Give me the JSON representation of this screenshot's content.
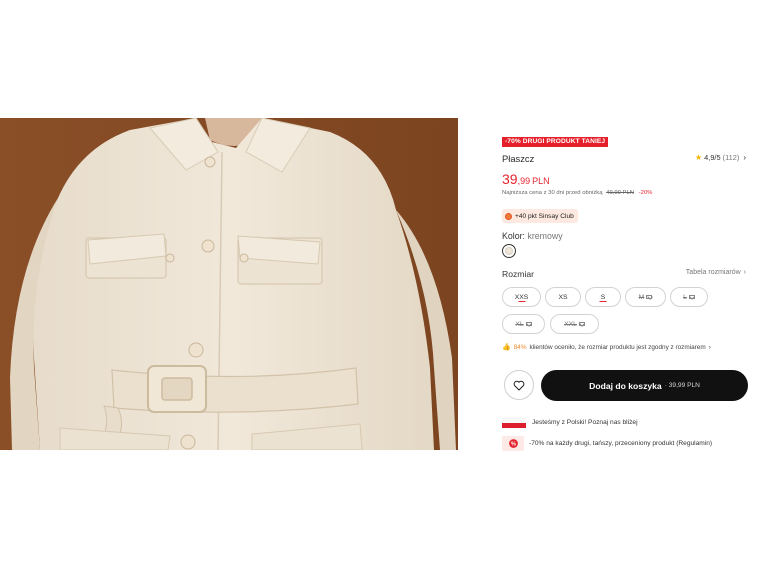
{
  "product": {
    "image_alt": "Płaszcz",
    "badge": "-70% DRUGI PRODUKT TANIEJ",
    "name": "Płaszcz",
    "rating": {
      "score": "4,9/5",
      "count": "(112)",
      "stars": 4.9
    },
    "price": {
      "integer": "39",
      "decimal": ",99",
      "currency": "PLN"
    },
    "lowest_price": {
      "text": "Najniższa cena z 30 dni przed obniżką",
      "old_price": "49,99 PLN",
      "discount": "-20%"
    },
    "club": {
      "label": "+40 pkt Sinsay Club"
    },
    "color": {
      "label": "Kolor:",
      "value": "kremowy",
      "swatch": "#efe6da"
    },
    "sizes": {
      "label": "Rozmiar",
      "table_link": "Tabela rozmiarów",
      "options": [
        {
          "name": "XXS",
          "available": true,
          "low_stock": true
        },
        {
          "name": "XS",
          "available": true,
          "low_stock": false
        },
        {
          "name": "S",
          "available": true,
          "low_stock": true
        },
        {
          "name": "M",
          "available": false,
          "notify": true
        },
        {
          "name": "L",
          "available": false,
          "notify": true
        },
        {
          "name": "XL",
          "available": false,
          "notify": true
        },
        {
          "name": "XXL",
          "available": false,
          "notify": true
        }
      ]
    },
    "fit_info": {
      "percent": "84%",
      "text": "klientów oceniło, że rozmiar produktu jest zgodny z rozmiarem"
    },
    "cart": {
      "label": "Dodaj do koszyka",
      "price": "· 39,99 PLN"
    },
    "info_rows": {
      "poland": "Jesteśmy z Polski! Poznaj nas bliżej",
      "promo": "-70% na każdy drugi, tańszy, przeceniony produkt (Regulamin)"
    }
  },
  "colors": {
    "accent": "#e3262f",
    "button": "#111111",
    "star": "#f4b400",
    "photo_bg": "#8a4f27",
    "coat": "#efe6da"
  }
}
